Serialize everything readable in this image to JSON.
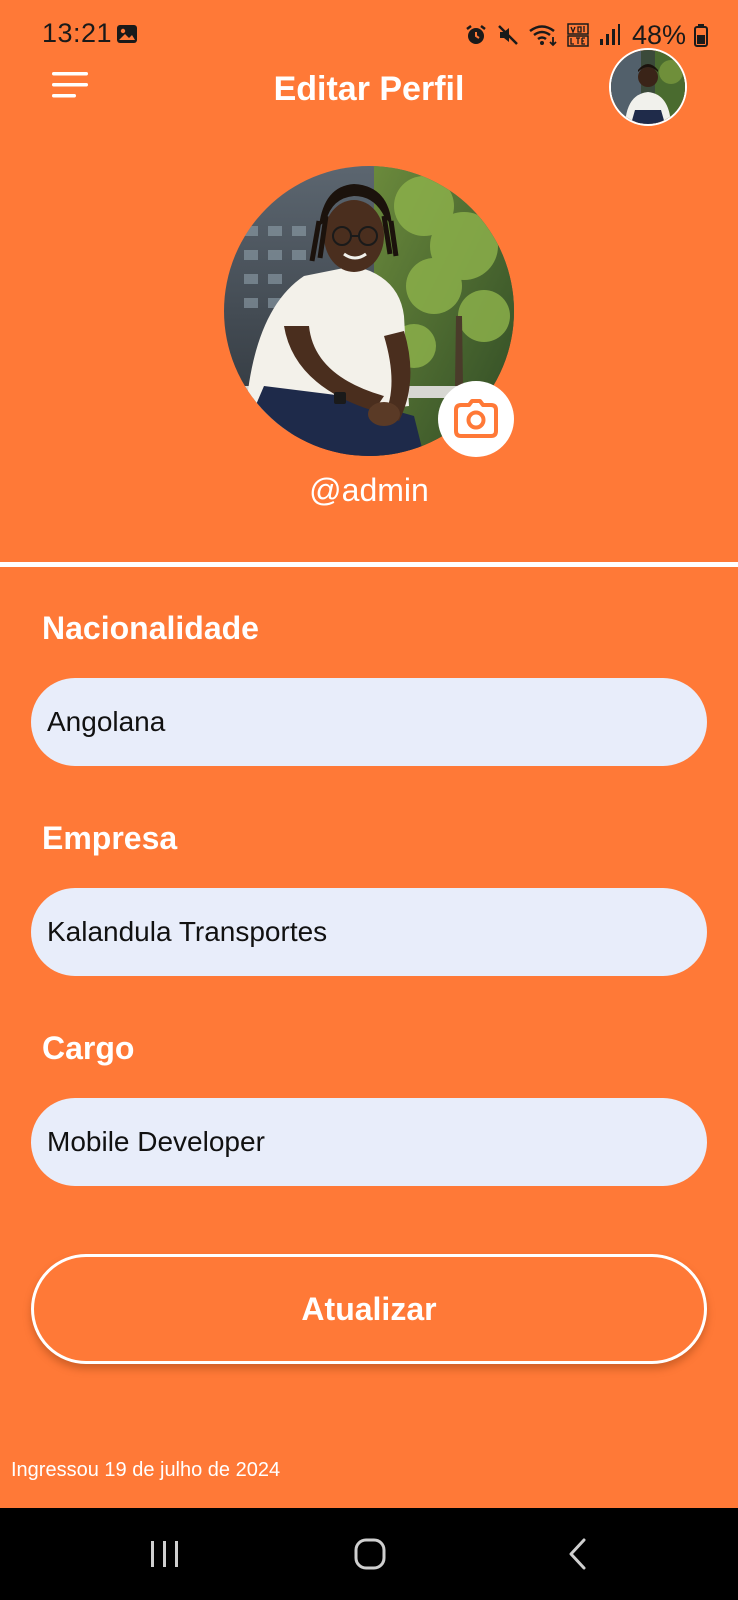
{
  "status_bar": {
    "time": "13:21",
    "battery": "48%"
  },
  "header": {
    "title": "Editar Perfil"
  },
  "profile": {
    "username": "@admin"
  },
  "form": {
    "nationality": {
      "label": "Nacionalidade",
      "value": "Angolana"
    },
    "company": {
      "label": "Empresa",
      "value": "Kalandula Transportes"
    },
    "role": {
      "label": "Cargo",
      "value": "Mobile Developer"
    }
  },
  "actions": {
    "update_label": "Atualizar"
  },
  "footer": {
    "joined": "Ingressou 19 de julho de 2024"
  },
  "icons": {
    "menu": "menu-icon",
    "camera": "camera-icon",
    "nav_recents": "recents-icon",
    "nav_home": "home-icon",
    "nav_back": "back-icon"
  },
  "colors": {
    "background": "#FF7937",
    "input_background": "#E8EDFA",
    "text_light": "#FFFFFF",
    "nav_bar": "#000000"
  }
}
